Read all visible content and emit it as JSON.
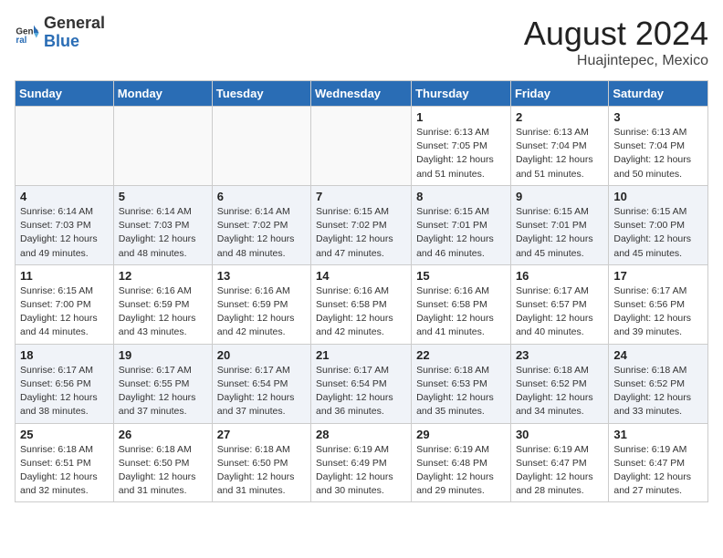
{
  "header": {
    "logo_general": "General",
    "logo_blue": "Blue",
    "month_year": "August 2024",
    "location": "Huajintepec, Mexico"
  },
  "days_of_week": [
    "Sunday",
    "Monday",
    "Tuesday",
    "Wednesday",
    "Thursday",
    "Friday",
    "Saturday"
  ],
  "weeks": [
    [
      {
        "day": "",
        "info": ""
      },
      {
        "day": "",
        "info": ""
      },
      {
        "day": "",
        "info": ""
      },
      {
        "day": "",
        "info": ""
      },
      {
        "day": "1",
        "info": "Sunrise: 6:13 AM\nSunset: 7:05 PM\nDaylight: 12 hours\nand 51 minutes."
      },
      {
        "day": "2",
        "info": "Sunrise: 6:13 AM\nSunset: 7:04 PM\nDaylight: 12 hours\nand 51 minutes."
      },
      {
        "day": "3",
        "info": "Sunrise: 6:13 AM\nSunset: 7:04 PM\nDaylight: 12 hours\nand 50 minutes."
      }
    ],
    [
      {
        "day": "4",
        "info": "Sunrise: 6:14 AM\nSunset: 7:03 PM\nDaylight: 12 hours\nand 49 minutes."
      },
      {
        "day": "5",
        "info": "Sunrise: 6:14 AM\nSunset: 7:03 PM\nDaylight: 12 hours\nand 48 minutes."
      },
      {
        "day": "6",
        "info": "Sunrise: 6:14 AM\nSunset: 7:02 PM\nDaylight: 12 hours\nand 48 minutes."
      },
      {
        "day": "7",
        "info": "Sunrise: 6:15 AM\nSunset: 7:02 PM\nDaylight: 12 hours\nand 47 minutes."
      },
      {
        "day": "8",
        "info": "Sunrise: 6:15 AM\nSunset: 7:01 PM\nDaylight: 12 hours\nand 46 minutes."
      },
      {
        "day": "9",
        "info": "Sunrise: 6:15 AM\nSunset: 7:01 PM\nDaylight: 12 hours\nand 45 minutes."
      },
      {
        "day": "10",
        "info": "Sunrise: 6:15 AM\nSunset: 7:00 PM\nDaylight: 12 hours\nand 45 minutes."
      }
    ],
    [
      {
        "day": "11",
        "info": "Sunrise: 6:15 AM\nSunset: 7:00 PM\nDaylight: 12 hours\nand 44 minutes."
      },
      {
        "day": "12",
        "info": "Sunrise: 6:16 AM\nSunset: 6:59 PM\nDaylight: 12 hours\nand 43 minutes."
      },
      {
        "day": "13",
        "info": "Sunrise: 6:16 AM\nSunset: 6:59 PM\nDaylight: 12 hours\nand 42 minutes."
      },
      {
        "day": "14",
        "info": "Sunrise: 6:16 AM\nSunset: 6:58 PM\nDaylight: 12 hours\nand 42 minutes."
      },
      {
        "day": "15",
        "info": "Sunrise: 6:16 AM\nSunset: 6:58 PM\nDaylight: 12 hours\nand 41 minutes."
      },
      {
        "day": "16",
        "info": "Sunrise: 6:17 AM\nSunset: 6:57 PM\nDaylight: 12 hours\nand 40 minutes."
      },
      {
        "day": "17",
        "info": "Sunrise: 6:17 AM\nSunset: 6:56 PM\nDaylight: 12 hours\nand 39 minutes."
      }
    ],
    [
      {
        "day": "18",
        "info": "Sunrise: 6:17 AM\nSunset: 6:56 PM\nDaylight: 12 hours\nand 38 minutes."
      },
      {
        "day": "19",
        "info": "Sunrise: 6:17 AM\nSunset: 6:55 PM\nDaylight: 12 hours\nand 37 minutes."
      },
      {
        "day": "20",
        "info": "Sunrise: 6:17 AM\nSunset: 6:54 PM\nDaylight: 12 hours\nand 37 minutes."
      },
      {
        "day": "21",
        "info": "Sunrise: 6:17 AM\nSunset: 6:54 PM\nDaylight: 12 hours\nand 36 minutes."
      },
      {
        "day": "22",
        "info": "Sunrise: 6:18 AM\nSunset: 6:53 PM\nDaylight: 12 hours\nand 35 minutes."
      },
      {
        "day": "23",
        "info": "Sunrise: 6:18 AM\nSunset: 6:52 PM\nDaylight: 12 hours\nand 34 minutes."
      },
      {
        "day": "24",
        "info": "Sunrise: 6:18 AM\nSunset: 6:52 PM\nDaylight: 12 hours\nand 33 minutes."
      }
    ],
    [
      {
        "day": "25",
        "info": "Sunrise: 6:18 AM\nSunset: 6:51 PM\nDaylight: 12 hours\nand 32 minutes."
      },
      {
        "day": "26",
        "info": "Sunrise: 6:18 AM\nSunset: 6:50 PM\nDaylight: 12 hours\nand 31 minutes."
      },
      {
        "day": "27",
        "info": "Sunrise: 6:18 AM\nSunset: 6:50 PM\nDaylight: 12 hours\nand 31 minutes."
      },
      {
        "day": "28",
        "info": "Sunrise: 6:19 AM\nSunset: 6:49 PM\nDaylight: 12 hours\nand 30 minutes."
      },
      {
        "day": "29",
        "info": "Sunrise: 6:19 AM\nSunset: 6:48 PM\nDaylight: 12 hours\nand 29 minutes."
      },
      {
        "day": "30",
        "info": "Sunrise: 6:19 AM\nSunset: 6:47 PM\nDaylight: 12 hours\nand 28 minutes."
      },
      {
        "day": "31",
        "info": "Sunrise: 6:19 AM\nSunset: 6:47 PM\nDaylight: 12 hours\nand 27 minutes."
      }
    ]
  ]
}
